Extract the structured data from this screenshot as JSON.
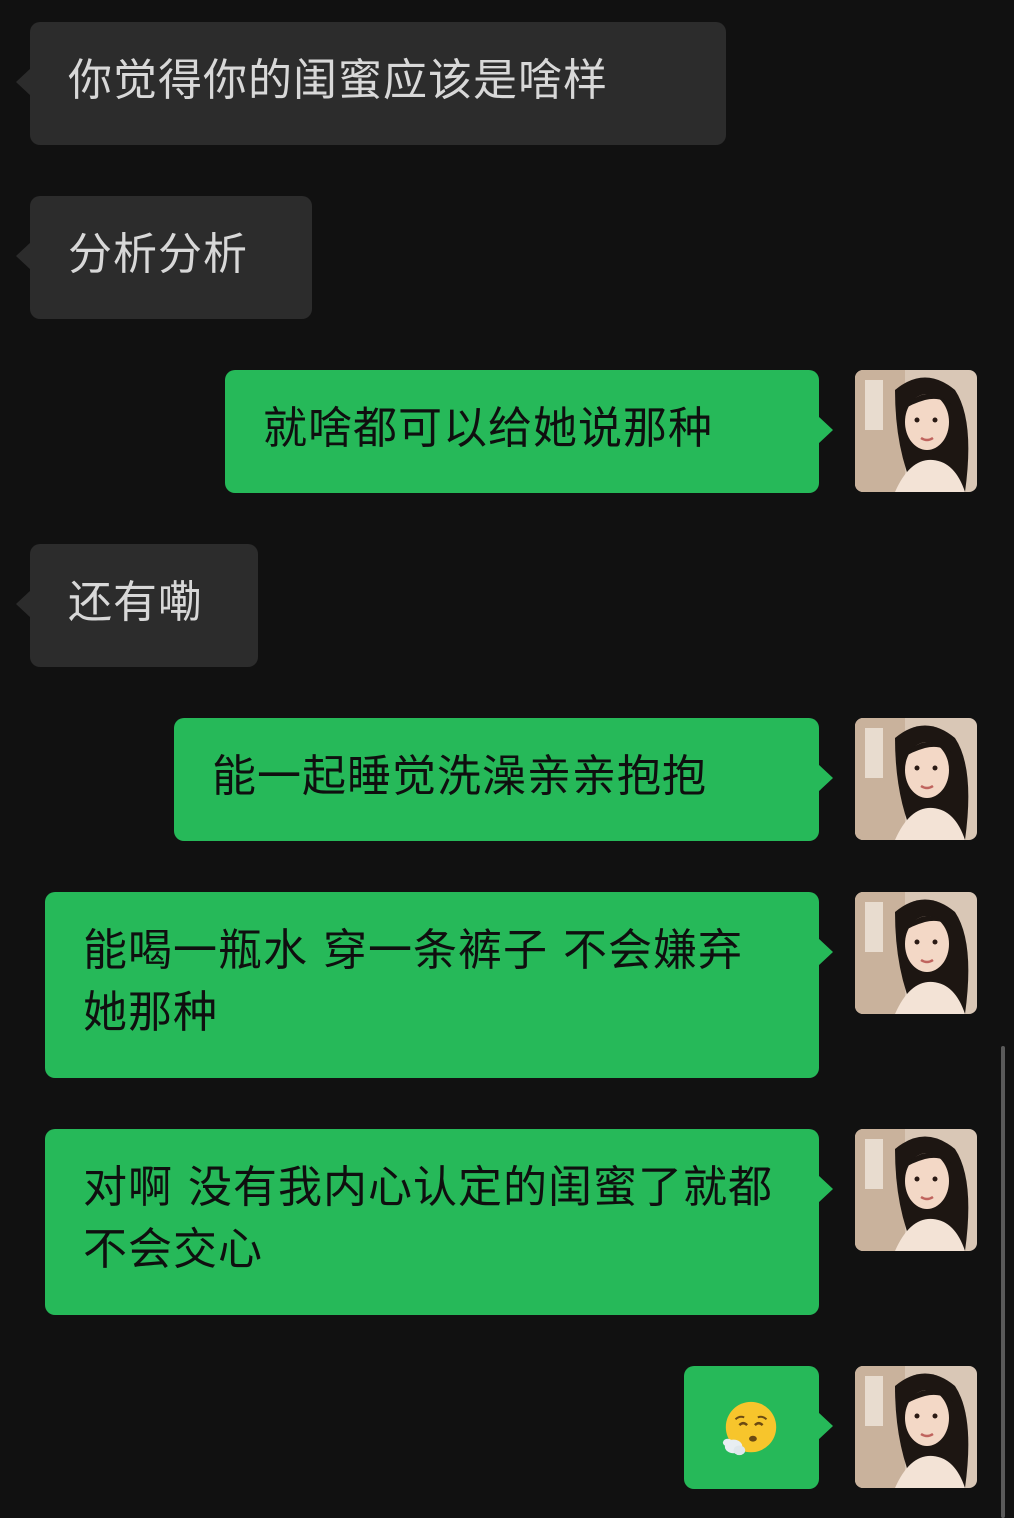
{
  "messages": [
    {
      "side": "in",
      "text": "你觉得你的闺蜜应该是啥样"
    },
    {
      "side": "in",
      "text": "分析分析"
    },
    {
      "side": "out",
      "text": "就啥都可以给她说那种"
    },
    {
      "side": "in",
      "text": "还有嘞"
    },
    {
      "side": "out",
      "text": "能一起睡觉洗澡亲亲抱抱"
    },
    {
      "side": "out",
      "text": "能喝一瓶水 穿一条裤子 不会嫌弃她那种"
    },
    {
      "side": "out",
      "text": "对啊 没有我内心认定的闺蜜了就都不会交心"
    },
    {
      "side": "out",
      "emoji": "face-exhaling-emoji"
    }
  ],
  "colors": {
    "background": "#111111",
    "incoming_bubble": "#2c2c2c",
    "outgoing_bubble": "#26b959",
    "incoming_text": "#d8d8d8",
    "outgoing_text": "#0f0f0f"
  }
}
